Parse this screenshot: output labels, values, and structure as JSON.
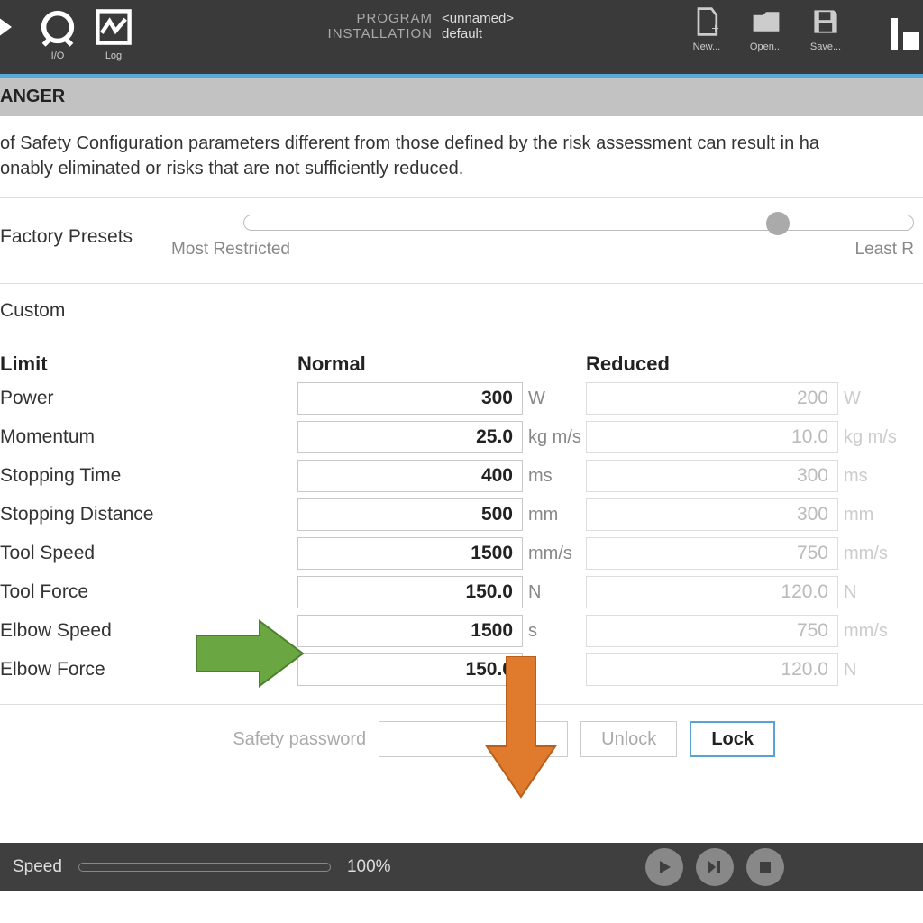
{
  "topbar": {
    "io_label": "I/O",
    "log_label": "Log",
    "program_label": "PROGRAM",
    "program_value": "<unnamed>",
    "installation_label": "INSTALLATION",
    "installation_value": "default",
    "new_label": "New...",
    "open_label": "Open...",
    "save_label": "Save..."
  },
  "danger_title": "ANGER",
  "body_text": "of Safety Configuration parameters different from those defined by the risk assessment can result in ha\nonably eliminated or risks that are not sufficiently reduced.",
  "presets": {
    "label": "Factory Presets",
    "left_label": "Most Restricted",
    "right_label": "Least R"
  },
  "custom_label": "Custom",
  "table": {
    "col_limit": "Limit",
    "col_normal": "Normal",
    "col_reduced": "Reduced",
    "rows": [
      {
        "label": "Power",
        "normal": "300",
        "n_unit": "W",
        "reduced": "200",
        "r_unit": "W"
      },
      {
        "label": "Momentum",
        "normal": "25.0",
        "n_unit": "kg m/s",
        "reduced": "10.0",
        "r_unit": "kg m/s"
      },
      {
        "label": "Stopping Time",
        "normal": "400",
        "n_unit": "ms",
        "reduced": "300",
        "r_unit": "ms"
      },
      {
        "label": "Stopping Distance",
        "normal": "500",
        "n_unit": "mm",
        "reduced": "300",
        "r_unit": "mm"
      },
      {
        "label": "Tool Speed",
        "normal": "1500",
        "n_unit": "mm/s",
        "reduced": "750",
        "r_unit": "mm/s"
      },
      {
        "label": "Tool Force",
        "normal": "150.0",
        "n_unit": "N",
        "reduced": "120.0",
        "r_unit": "N"
      },
      {
        "label": "Elbow Speed",
        "normal": "1500",
        "n_unit": "   s",
        "reduced": "750",
        "r_unit": "mm/s"
      },
      {
        "label": "Elbow Force",
        "normal": "150.0",
        "n_unit": "",
        "reduced": "120.0",
        "r_unit": "N"
      }
    ]
  },
  "pwd": {
    "label": "Safety password",
    "unlock": "Unlock",
    "lock": "Lock"
  },
  "bottom": {
    "speed_label": "Speed",
    "speed_value": "100%"
  }
}
